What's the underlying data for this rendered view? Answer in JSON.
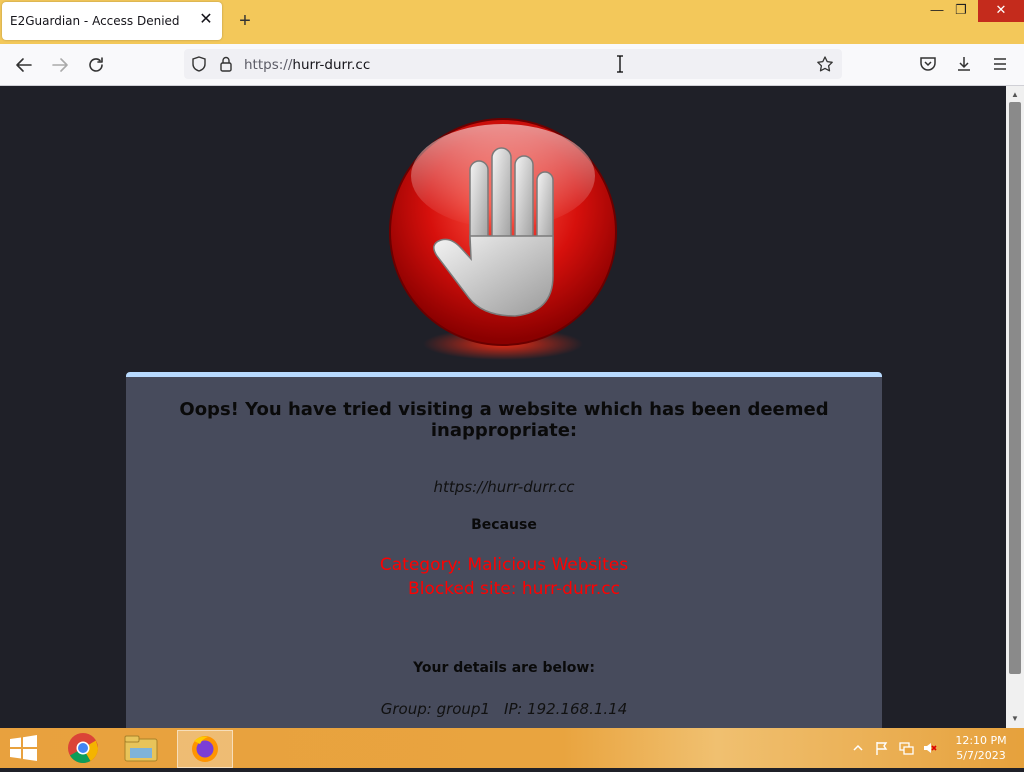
{
  "browser": {
    "tab_title": "E2Guardian - Access Denied",
    "tab_close": "✕",
    "new_tab": "+",
    "url_scheme": "https://",
    "url_host": "hurr-durr.cc",
    "window_minimize": "—",
    "window_restore": "❐",
    "window_close": "✕",
    "accent_color": "#f3c85a"
  },
  "page": {
    "heading": "Oops! You have tried visiting a website which has been deemed inappropriate:",
    "blocked_url": "https://hurr-durr.cc",
    "because_label": "Because",
    "reason_category": "Category: Malicious Websites",
    "reason_blocked": "Blocked site: hurr-durr.cc",
    "details_heading": "Your details are below:",
    "group": "Group: group1",
    "ip": "IP: 192.168.1.14",
    "reason_color": "#ff0000",
    "panel_color": "#474b5c"
  },
  "taskbar": {
    "time": "12:10 PM",
    "date": "5/7/2023",
    "apps": [
      "start-icon",
      "chrome-icon",
      "file-explorer-icon",
      "firefox-icon"
    ]
  }
}
